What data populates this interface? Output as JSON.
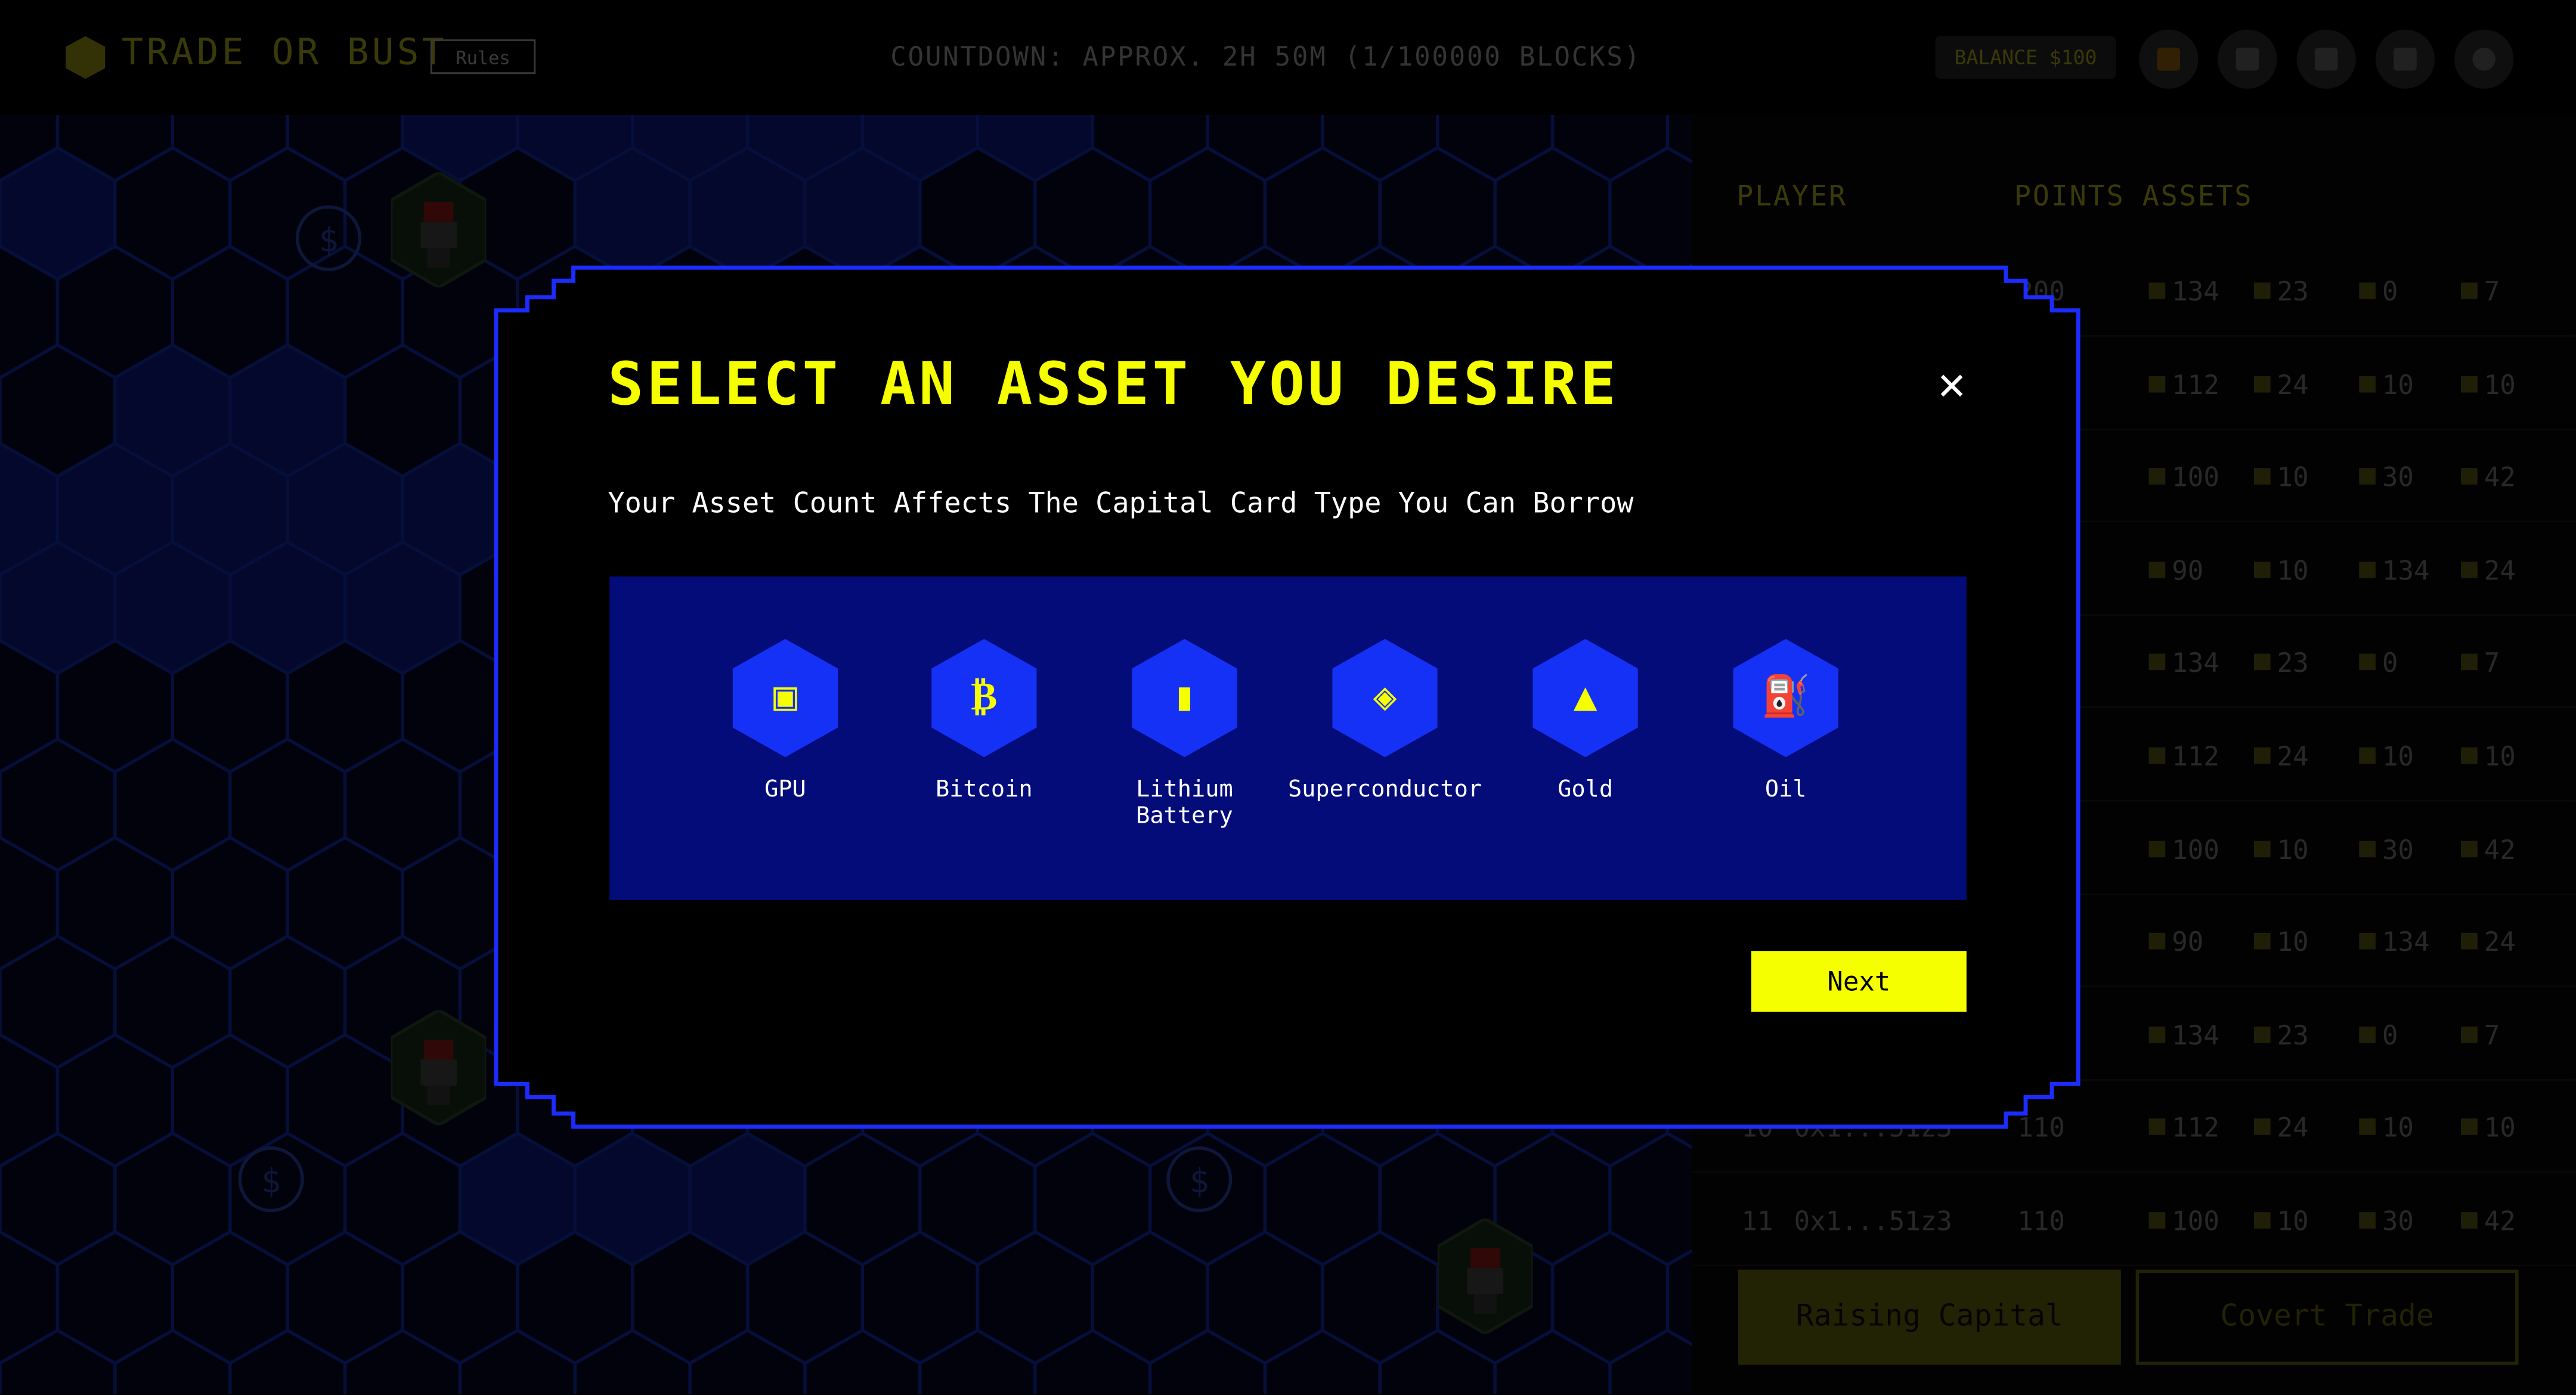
{
  "header": {
    "title": "TRADE OR BUST",
    "rules_label": "Rules",
    "countdown": "COUNTDOWN: APPROX. 2H 50M (1/100000 BLOCKS)",
    "balance": "BALANCE $100",
    "icons": [
      "badge-icon",
      "card-icon",
      "inventory-icon",
      "document-icon",
      "profile-icon"
    ]
  },
  "leaderboard": {
    "columns": [
      "PLAYER",
      "POINTS",
      "ASSETS"
    ],
    "rows": [
      {
        "rank": "",
        "player": "",
        "points": "200",
        "assets": [
          "134",
          "23",
          "0",
          "7"
        ]
      },
      {
        "rank": "",
        "player": "",
        "points": "",
        "assets": [
          "112",
          "24",
          "10",
          "10"
        ]
      },
      {
        "rank": "",
        "player": "",
        "points": "",
        "assets": [
          "100",
          "10",
          "30",
          "42"
        ]
      },
      {
        "rank": "",
        "player": "",
        "points": "",
        "assets": [
          "90",
          "10",
          "134",
          "24"
        ]
      },
      {
        "rank": "",
        "player": "",
        "points": "",
        "assets": [
          "134",
          "23",
          "0",
          "7"
        ]
      },
      {
        "rank": "",
        "player": "",
        "points": "",
        "assets": [
          "112",
          "24",
          "10",
          "10"
        ]
      },
      {
        "rank": "",
        "player": "",
        "points": "",
        "assets": [
          "100",
          "10",
          "30",
          "42"
        ]
      },
      {
        "rank": "",
        "player": "",
        "points": "",
        "assets": [
          "90",
          "10",
          "134",
          "24"
        ]
      },
      {
        "rank": "",
        "player": "",
        "points": "",
        "assets": [
          "134",
          "23",
          "0",
          "7"
        ]
      },
      {
        "rank": "10",
        "player": "0x1...51z3",
        "points": "110",
        "assets": [
          "112",
          "24",
          "10",
          "10"
        ]
      },
      {
        "rank": "11",
        "player": "0x1...51z3",
        "points": "110",
        "assets": [
          "100",
          "10",
          "30",
          "42"
        ]
      }
    ],
    "raise_label": "Raising Capital",
    "covert_label": "Covert Trade"
  },
  "modal": {
    "title": "SELECT AN ASSET YOU DESIRE",
    "subtitle": "Your Asset Count Affects The Capital Card Type You Can Borrow",
    "assets": [
      {
        "label": "GPU",
        "icon": "gpu-icon"
      },
      {
        "label": "Bitcoin",
        "icon": "bitcoin-icon"
      },
      {
        "label": "Lithium\nBattery",
        "icon": "battery-icon"
      },
      {
        "label": "Superconductor",
        "icon": "superconductor-icon"
      },
      {
        "label": "Gold",
        "icon": "gold-icon"
      },
      {
        "label": "Oil",
        "icon": "oil-icon"
      }
    ],
    "next_label": "Next",
    "colors": {
      "accent": "#f6ff00",
      "panel": "#040c7a",
      "border": "#1c2cff",
      "hex": "#1531f5"
    }
  }
}
